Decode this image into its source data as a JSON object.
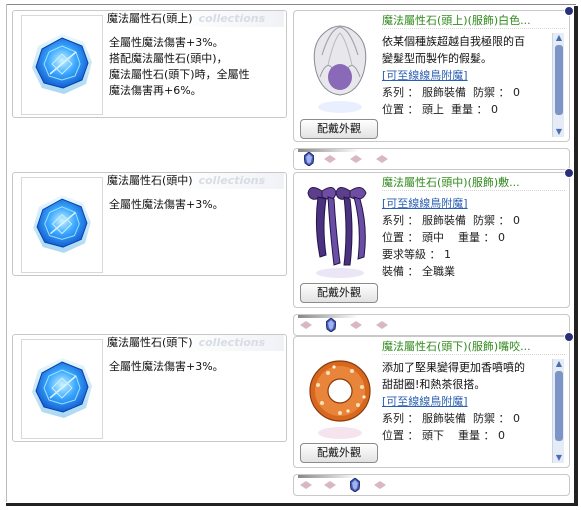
{
  "items": [
    {
      "title": "魔法屬性石(頭上)",
      "watermark": "collections",
      "description": "全屬性魔法傷害+3%。\n搭配魔法屬性石(頭中)，\n魔法屬性石(頭下)時，全屬性\n魔法傷害再+6%。"
    },
    {
      "title": "魔法屬性石(頭中)",
      "watermark": "collections",
      "description": "全屬性魔法傷害+3%。"
    },
    {
      "title": "魔法屬性石(頭下)",
      "watermark": "collections",
      "description": "全屬性魔法傷害+3%。"
    }
  ],
  "costumes": [
    {
      "title": "魔法屬性石(頭上)(服飾)白色...",
      "desc_lines": [
        "依某個種族超越自我極限的百",
        "變髮型而製作的假髮。"
      ],
      "link": "[可至線線鳥附魔]",
      "series_label": "系列 ： 服飾裝備",
      "defense_label": "防禦 ： 0",
      "position_label": "位置 ： 頭上",
      "weight_label": "重量 ： 0",
      "extra_lines": [],
      "button": "配戴外觀"
    },
    {
      "title": "魔法屬性石(頭中)(服飾)敷...",
      "desc_lines": [],
      "link": "[可至線線鳥附魔]",
      "series_label": "系列 ： 服飾裝備",
      "defense_label": "防禦 ： 0",
      "position_label": "位置 ： 頭中",
      "weight_label": "重量 ： 0",
      "extra_lines": [
        "要求等級 ： 1",
        "裝備 ： 全職業"
      ],
      "button": "配戴外觀"
    },
    {
      "title": "魔法屬性石(頭下)(服飾)嘴咬...",
      "desc_lines": [
        "添加了堅果變得更加香噴噴的",
        "甜甜圈!和熱茶很搭。"
      ],
      "link": "[可至線線鳥附魔]",
      "series_label": "系列 ： 服飾裝備",
      "defense_label": "防禦 ： 0",
      "position_label": "位置 ： 頭下",
      "weight_label": "重量 ： 0",
      "extra_lines": [],
      "button": "配戴外觀"
    }
  ],
  "colors": {
    "title_green": "#2f8a1b",
    "link_blue": "#2a5fb0",
    "gem_blue": "#1e90ff",
    "diamond_pink": "#d9b8c4"
  },
  "icons": {
    "item": "blue-octagon-gem-icon",
    "costume_1": "white-silver-wig-icon",
    "costume_2": "purple-ribbon-bows-icon",
    "costume_3": "glazed-donut-icon"
  }
}
